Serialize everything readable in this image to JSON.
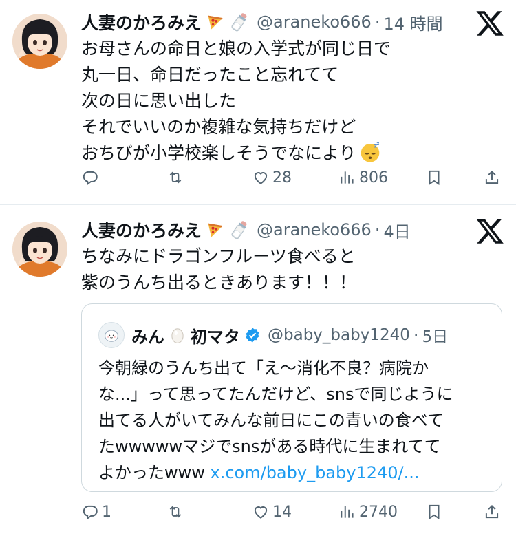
{
  "tweets": [
    {
      "author": "人妻のかろみえ",
      "author_emojis": [
        "pizza",
        "baby-bottle"
      ],
      "handle": "@araneko666",
      "time": "14 時間",
      "lines": [
        "お母さんの命日と娘の入学式が同じ日で",
        "丸一日、命日だったこと忘れてて",
        "次の日に思い出した",
        "それでいいのか複雑な気持ちだけど",
        "おちびが小学校楽しそうでなにより"
      ],
      "line_end_emoji": "sleeping-face",
      "actions": {
        "replies": "",
        "retweets": "",
        "likes": "28",
        "views": "806"
      }
    },
    {
      "author": "人妻のかろみえ",
      "author_emojis": [
        "pizza",
        "baby-bottle"
      ],
      "handle": "@araneko666",
      "time": "4日",
      "lines": [
        "ちなみにドラゴンフルーツ食べると",
        "紫のうんち出るときあります！！！"
      ],
      "quote": {
        "name_part1": "みん",
        "name_emoji": "egg",
        "name_part2": "初マタ",
        "verified": true,
        "handle": "@baby_baby1240",
        "time": "5日",
        "lines": [
          "今朝緑のうんち出て「え〜消化不良？病院か",
          "な...」って思ってたんだけど、snsで同じように",
          "出てる人がいてみんな前日にこの青いの食べて",
          "たwwwwwマジでsnsがある時代に生まれてて"
        ],
        "last_line_text": "よかったwww ",
        "link": "x.com/baby_baby1240/..."
      },
      "actions": {
        "replies": "1",
        "retweets": "",
        "likes": "14",
        "views": "2740"
      }
    }
  ],
  "colors": {
    "text": "#0f1419",
    "muted": "#536471",
    "link": "#1d9bf0",
    "verified": "#1d9bf0",
    "border": "#cfd9de"
  }
}
